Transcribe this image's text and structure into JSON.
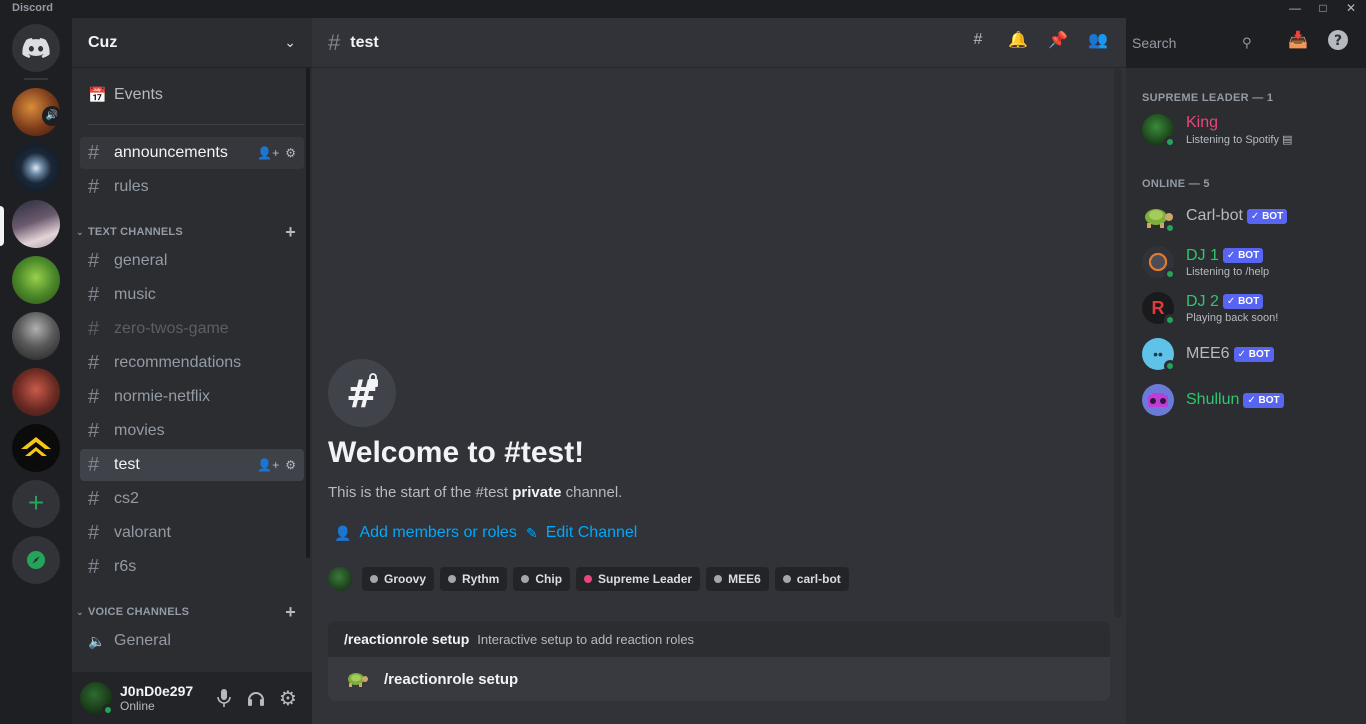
{
  "window": {
    "app_name": "Discord"
  },
  "guild": {
    "name": "Cuz"
  },
  "sidebar": {
    "events_label": "Events",
    "top_channels": [
      {
        "name": "announcements"
      },
      {
        "name": "rules"
      }
    ],
    "text_category": "TEXT CHANNELS",
    "text_channels": [
      {
        "name": "general"
      },
      {
        "name": "music"
      },
      {
        "name": "zero-twos-game"
      },
      {
        "name": "recommendations"
      },
      {
        "name": "normie-netflix"
      },
      {
        "name": "movies"
      },
      {
        "name": "test"
      },
      {
        "name": "cs2"
      },
      {
        "name": "valorant"
      },
      {
        "name": "r6s"
      }
    ],
    "voice_category": "VOICE CHANNELS",
    "voice_channels": [
      {
        "name": "General"
      }
    ]
  },
  "user": {
    "name": "J0nD0e297",
    "status": "Online"
  },
  "channel": {
    "name": "test"
  },
  "search": {
    "placeholder": "Search"
  },
  "welcome": {
    "title": "Welcome to #test!",
    "sub_prefix": "This is the start of the #test ",
    "sub_bold": "private",
    "sub_suffix": " channel.",
    "add_members": "Add members or roles",
    "edit_channel": "Edit Channel"
  },
  "roles": [
    {
      "name": "Groovy",
      "color": "#a3a6aa"
    },
    {
      "name": "Rythm",
      "color": "#a3a6aa"
    },
    {
      "name": "Chip",
      "color": "#a3a6aa"
    },
    {
      "name": "Supreme Leader",
      "color": "#e8467c"
    },
    {
      "name": "MEE6",
      "color": "#a3a6aa"
    },
    {
      "name": "carl-bot",
      "color": "#a3a6aa"
    }
  ],
  "command": {
    "name": "/reactionrole setup",
    "description": "Interactive setup to add reaction roles",
    "input_value": "/reactionrole setup"
  },
  "members": {
    "group1": "SUPREME LEADER — 1",
    "group2": "ONLINE — 5",
    "bot_tag": "BOT",
    "list": [
      {
        "name": "King",
        "activity": "Listening to Spotify",
        "color": "#e8467c"
      },
      {
        "name": "Carl-bot",
        "activity": "",
        "color": "#b5bac1"
      },
      {
        "name": "DJ 1",
        "activity": "Listening to /help",
        "color": "#2dc770"
      },
      {
        "name": "DJ 2",
        "activity": "Playing back soon!",
        "color": "#2dc770"
      },
      {
        "name": "MEE6",
        "activity": "",
        "color": "#b5bac1"
      },
      {
        "name": "Shullun",
        "activity": "",
        "color": "#2dc770"
      }
    ]
  }
}
